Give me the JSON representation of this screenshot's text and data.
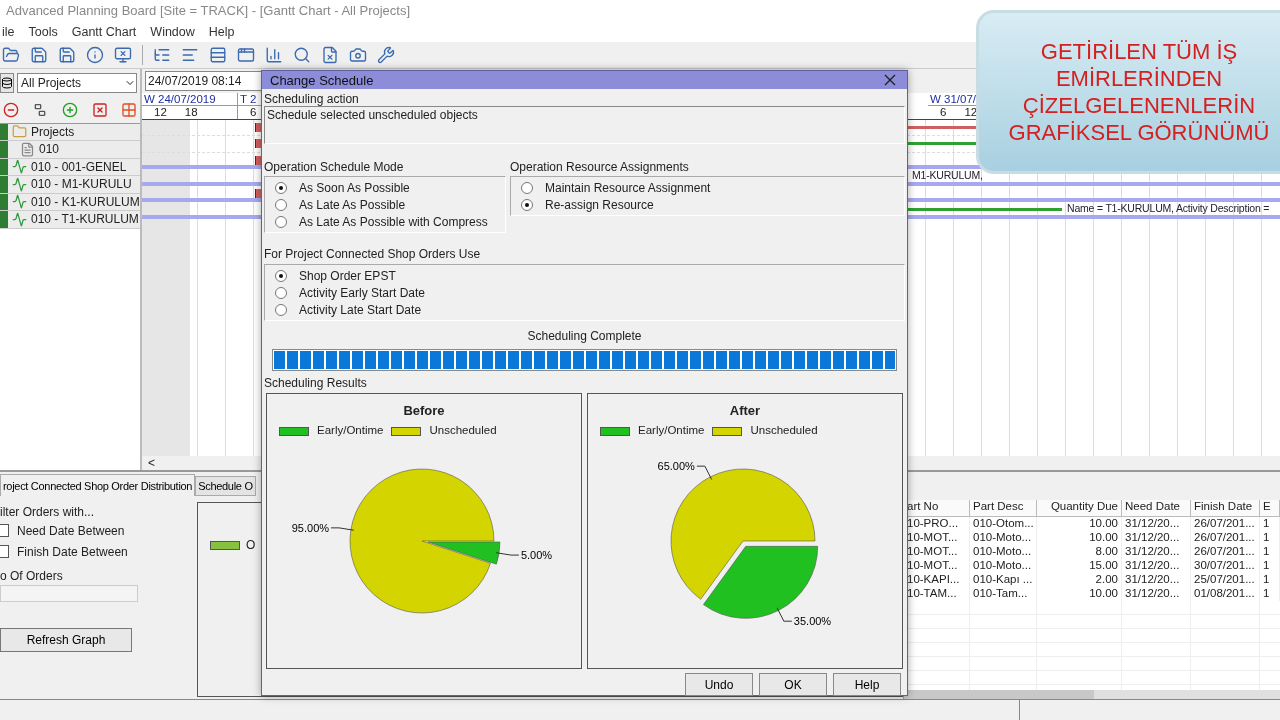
{
  "window": {
    "title": "Advanced Planning Board [Site = TRACK] - [Gantt Chart - All Projects]"
  },
  "menu": [
    "ile",
    "Tools",
    "Gantt Chart",
    "Window",
    "Help"
  ],
  "project_filter": {
    "value": "All Projects"
  },
  "date_field": {
    "value": "24/07/2019 08:14"
  },
  "tree": [
    {
      "kind": "folder",
      "label": "Projects"
    },
    {
      "kind": "file",
      "label": "010"
    },
    {
      "kind": "activity",
      "label": "010 - 001-GENEL"
    },
    {
      "kind": "activity",
      "label": "010 - M1-KURULU"
    },
    {
      "kind": "activity",
      "label": "010 - K1-KURULUM"
    },
    {
      "kind": "activity",
      "label": "010 - T1-KURULUM"
    }
  ],
  "timescale": {
    "left": [
      {
        "day": "W 24/07/2019",
        "hours": [
          "12",
          "18"
        ]
      },
      {
        "day": "T 2",
        "hours": [
          "6"
        ]
      }
    ],
    "right": {
      "day": "W 31/07/",
      "hours": [
        "6",
        "12"
      ]
    }
  },
  "gantt_scroll": "<",
  "gantt_rows": [
    {
      "flag": true,
      "bar": false,
      "color": "#d06060"
    },
    {
      "flag": true,
      "bar": false,
      "color": "#30a030"
    },
    {
      "flag": true,
      "bar": true
    },
    {
      "flag": false,
      "bar": true,
      "note": "M1-KURULUM,"
    },
    {
      "flag": true,
      "bar": true
    },
    {
      "flag": false,
      "bar": true,
      "color": "#30a030",
      "note": "Name = T1-KURULUM, Activity Description ="
    }
  ],
  "caption": [
    "GETİRİLEN TÜM İŞ",
    "EMİRLERİNDEN",
    "ÇİZELGELENENLERİN",
    "GRAFİKSEL GÖRÜNÜMÜ"
  ],
  "bottom_tabs": [
    {
      "label": "roject Connected Shop Order Distribution",
      "selected": true
    },
    {
      "label": "Schedule O",
      "selected": false
    }
  ],
  "filter": {
    "title": "ilter Orders with...",
    "options": [
      {
        "label": "Need Date Between",
        "checked": false
      },
      {
        "label": "Finish Date Between",
        "checked": false
      }
    ],
    "count_label": "o Of Orders",
    "button": "Refresh Graph"
  },
  "distribution_legend": {
    "label": "O",
    "color": "#88c040"
  },
  "orders_table": {
    "columns": [
      "art No",
      "Part Desc",
      "Quantity Due",
      "Need Date",
      "Finish Date",
      "E"
    ],
    "rows": [
      [
        "10-PRO...",
        "010-Otom...",
        "10.00",
        "31/12/20...",
        "26/07/201...",
        "1"
      ],
      [
        "10-MOT...",
        "010-Moto...",
        "10.00",
        "31/12/20...",
        "26/07/201...",
        "1"
      ],
      [
        "10-MOT...",
        "010-Moto...",
        "8.00",
        "31/12/20...",
        "26/07/201...",
        "1"
      ],
      [
        "10-MOT...",
        "010-Moto...",
        "15.00",
        "31/12/20...",
        "30/07/201...",
        "1"
      ],
      [
        "10-KAPI...",
        "010-Kapı ...",
        "2.00",
        "31/12/20...",
        "25/07/201...",
        "1"
      ],
      [
        "10-TAM...",
        "010-Tam...",
        "10.00",
        "31/12/20...",
        "01/08/201...",
        "1"
      ]
    ]
  },
  "dialog": {
    "title": "Change Schedule",
    "action_label": "Scheduling action",
    "action_text": "Schedule selected unscheduled objects",
    "mode": {
      "label": "Operation Schedule Mode",
      "options": [
        {
          "label": "As Soon As Possible",
          "selected": true
        },
        {
          "label": "As Late As Possible",
          "selected": false
        },
        {
          "label": "As Late As Possible with Compress",
          "selected": false
        }
      ]
    },
    "resource": {
      "label": "Operation Resource Assignments",
      "options": [
        {
          "label": "Maintain Resource Assignment",
          "selected": false
        },
        {
          "label": "Re-assign Resource",
          "selected": true
        }
      ]
    },
    "shop_orders": {
      "label": "For Project Connected Shop Orders Use",
      "options": [
        {
          "label": "Shop Order EPST",
          "selected": true
        },
        {
          "label": "Activity Early Start Date",
          "selected": false
        },
        {
          "label": "Activity Late Start Date",
          "selected": false
        }
      ]
    },
    "status": "Scheduling Complete",
    "progress": {
      "level": 1
    },
    "results_label": "Scheduling Results",
    "results": [
      {
        "chart_data": {
          "type": "pie",
          "title": "Before",
          "categories": [
            "Early/Ontime",
            "Unscheduled"
          ],
          "series": [
            {
              "values": [
                5,
                95
              ]
            }
          ],
          "value_labels": [
            "5.00%",
            "95.00%"
          ]
        },
        "legend": [
          {
            "color": "#20c020"
          },
          {
            "color": "#d4d400"
          }
        ]
      },
      {
        "chart_data": {
          "type": "pie",
          "title": "After",
          "categories": [
            "Early/Ontime",
            "Unscheduled"
          ],
          "series": [
            {
              "values": [
                35,
                65
              ]
            }
          ],
          "value_labels": [
            "35.00%",
            "65.00%"
          ]
        },
        "legend": [
          {
            "color": "#20c020"
          },
          {
            "color": "#d4d400"
          }
        ]
      }
    ],
    "buttons": [
      "Undo",
      "OK",
      "Help"
    ]
  }
}
